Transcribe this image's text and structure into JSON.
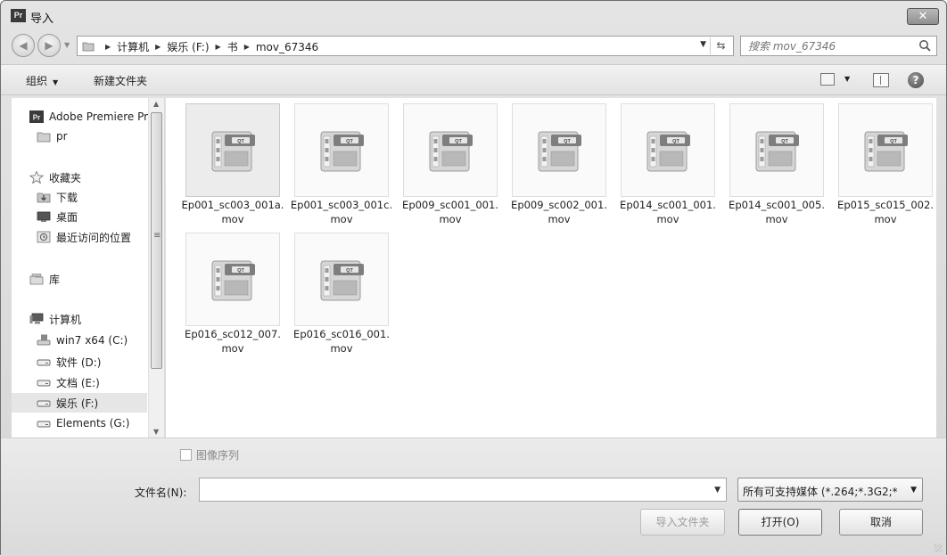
{
  "window": {
    "title": "导入",
    "app_icon": "Pr",
    "close": "✕"
  },
  "address": {
    "crumbs": [
      "计算机",
      "娱乐 (F:)",
      "书",
      "mov_67346"
    ],
    "search_placeholder": "搜索 mov_67346"
  },
  "toolbar": {
    "organize": "组织",
    "new_folder": "新建文件夹",
    "help": "?"
  },
  "nav": {
    "items": [
      {
        "label": "Adobe Premiere Pr",
        "icon": "premiere-icon",
        "indent": 0
      },
      {
        "label": "pr",
        "icon": "folder-icon",
        "indent": 1
      },
      {
        "label": "收藏夹",
        "icon": "star-icon",
        "indent": 0
      },
      {
        "label": "下载",
        "icon": "download-folder-icon",
        "indent": 1
      },
      {
        "label": "桌面",
        "icon": "desktop-icon",
        "indent": 1
      },
      {
        "label": "最近访问的位置",
        "icon": "recent-places-icon",
        "indent": 1
      },
      {
        "label": "库",
        "icon": "library-icon",
        "indent": 0
      },
      {
        "label": "计算机",
        "icon": "computer-icon",
        "indent": 0
      },
      {
        "label": "win7 x64 (C:)",
        "icon": "system-drive-icon",
        "indent": 1
      },
      {
        "label": "软件 (D:)",
        "icon": "drive-icon",
        "indent": 1
      },
      {
        "label": "文档 (E:)",
        "icon": "drive-icon",
        "indent": 1
      },
      {
        "label": "娱乐 (F:)",
        "icon": "drive-icon",
        "indent": 1,
        "selected": true
      },
      {
        "label": "Elements (G:)",
        "icon": "drive-icon",
        "indent": 1
      }
    ]
  },
  "files": [
    {
      "name": "Ep001_sc003_001a.mov",
      "selected": true
    },
    {
      "name": "Ep001_sc003_001c.mov"
    },
    {
      "name": "Ep009_sc001_001.mov"
    },
    {
      "name": "Ep009_sc002_001.mov"
    },
    {
      "name": "Ep014_sc001_001.mov"
    },
    {
      "name": "Ep014_sc001_005.mov"
    },
    {
      "name": "Ep015_sc015_002.mov"
    },
    {
      "name": "Ep016_sc012_007.mov"
    },
    {
      "name": "Ep016_sc016_001.mov"
    }
  ],
  "file_icon_label": "QT",
  "bottom": {
    "image_sequence": "图像序列",
    "filename_label": "文件名(N):",
    "filename_value": "",
    "filetype_value": "所有可支持媒体 (*.264;*.3G2;*",
    "import_folder": "导入文件夹",
    "open": "打开(O)",
    "cancel": "取消"
  },
  "colors": {
    "selected_bg": "#e6e6e6",
    "window_bg": "#dcdcdc"
  }
}
